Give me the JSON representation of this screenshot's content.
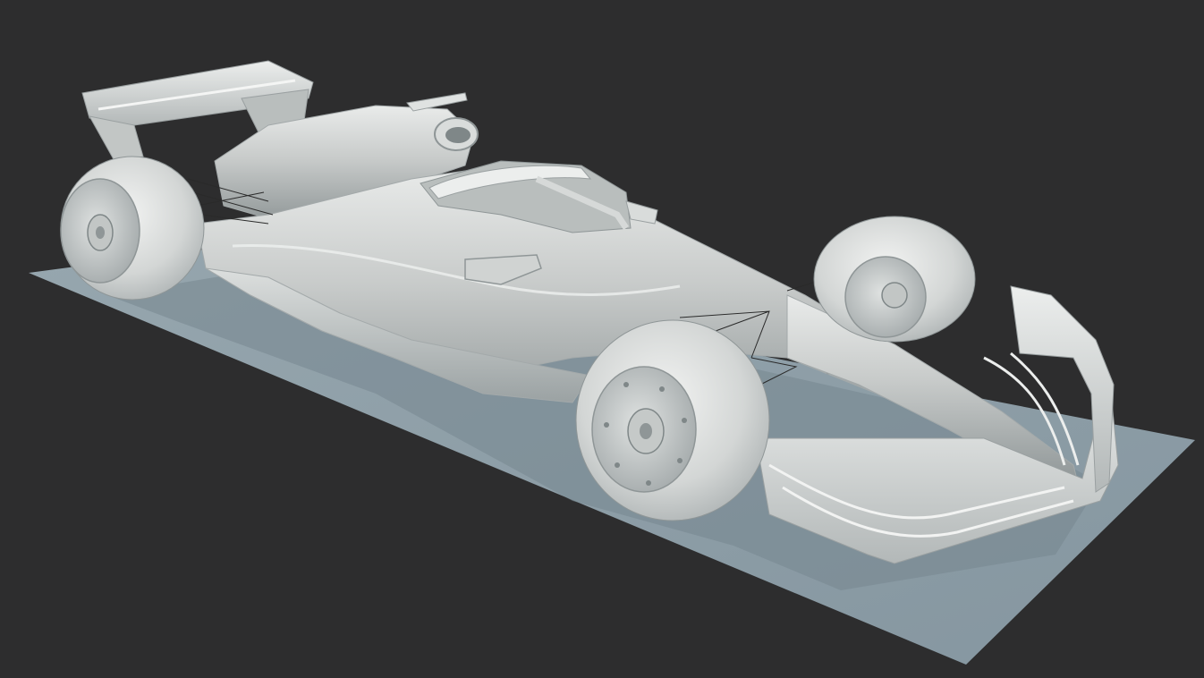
{
  "viewport": {
    "background": "#2d2d2e"
  },
  "scene": {
    "subject": "f1-car-clay-render",
    "colors": {
      "ground": "#8d9ea6",
      "ground_shadow": "#72838b",
      "body": "#c9cccb",
      "body_highlight": "#e6e8e7",
      "body_shadow": "#9aa0a1",
      "tire": "#cfd2d1",
      "tire_highlight": "#eef0ef",
      "rim": "#b9bdbd",
      "wire": "#2a2a2a"
    }
  }
}
